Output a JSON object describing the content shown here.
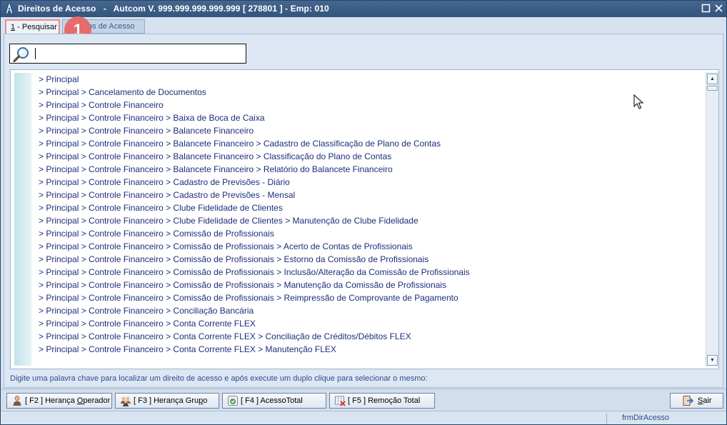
{
  "window": {
    "title": "Direitos de Acesso   -   Autcom V. 999.999.999.999.999 [ 278801 ] - Emp: 010",
    "icons": [
      "app-logo-icon",
      "restore-icon",
      "close-icon"
    ]
  },
  "tabs": [
    {
      "shortcut": "1",
      "label": " - Pesquisar"
    },
    {
      "label": "tos de Acesso"
    }
  ],
  "annotation": {
    "badge": "1"
  },
  "search": {
    "value": "",
    "placeholder": "",
    "icon": "magnifier-icon"
  },
  "results": [
    "> Principal",
    "> Principal > Cancelamento de Documentos",
    "> Principal > Controle Financeiro",
    "> Principal > Controle Financeiro > Baixa de Boca de Caixa",
    "> Principal > Controle Financeiro > Balancete Financeiro",
    "> Principal > Controle Financeiro > Balancete Financeiro > Cadastro de Classificação de Plano de Contas",
    "> Principal > Controle Financeiro > Balancete Financeiro > Classificação do Plano de Contas",
    "> Principal > Controle Financeiro > Balancete Financeiro > Relatório do Balancete Financeiro",
    "> Principal > Controle Financeiro > Cadastro de Previsões - Diário",
    "> Principal > Controle Financeiro > Cadastro de Previsões - Mensal",
    "> Principal > Controle Financeiro > Clube Fidelidade de Clientes",
    "> Principal > Controle Financeiro > Clube Fidelidade de Clientes > Manutenção de Clube Fidelidade",
    "> Principal > Controle Financeiro > Comissão de Profissionais",
    "> Principal > Controle Financeiro > Comissão de Profissionais > Acerto de Contas de Profissionais",
    "> Principal > Controle Financeiro > Comissão de Profissionais > Estorno da Comissão de Profissionais",
    "> Principal > Controle Financeiro > Comissão de Profissionais > Inclusão/Alteração da Comissão de Profissionais",
    "> Principal > Controle Financeiro > Comissão de Profissionais > Manutenção da Comissão de Profissionais",
    "> Principal > Controle Financeiro > Comissão de Profissionais > Reimpressão de Comprovante de Pagamento",
    "> Principal > Controle Financeiro > Conciliação Bancária",
    "> Principal > Controle Financeiro > Conta Corrente FLEX",
    "> Principal > Controle Financeiro > Conta Corrente FLEX > Conciliação de Créditos/Débitos FLEX",
    "> Principal > Controle Financeiro > Conta Corrente FLEX > Manutenção FLEX"
  ],
  "hint": "Digite uma palavra chave para localizar um direito de acesso e após execute um duplo clique para selecionar o mesmo:",
  "buttons": {
    "f2": {
      "pre": "[ F2 ] Herança ",
      "ul": "O",
      "post": "perador",
      "icon": "user-icon"
    },
    "f3": {
      "pre": "[ F3 ] Herança Gru",
      "ul": "p",
      "post": "o",
      "icon": "group-icon"
    },
    "f4": {
      "label": "[ F4 ] AcessoTotal",
      "icon": "access-total-icon"
    },
    "f5": {
      "label": "[ F5 ] Remoção Total",
      "icon": "remove-total-icon"
    },
    "exit": {
      "ul": "S",
      "post": "air",
      "icon": "exit-icon"
    }
  },
  "status": {
    "form_name": "frmDirAcesso"
  },
  "colors": {
    "titlebar": "#3a5c84",
    "list_text": "#1a2f7a",
    "badge": "#e56c6c",
    "panel": "#dde7f3"
  }
}
